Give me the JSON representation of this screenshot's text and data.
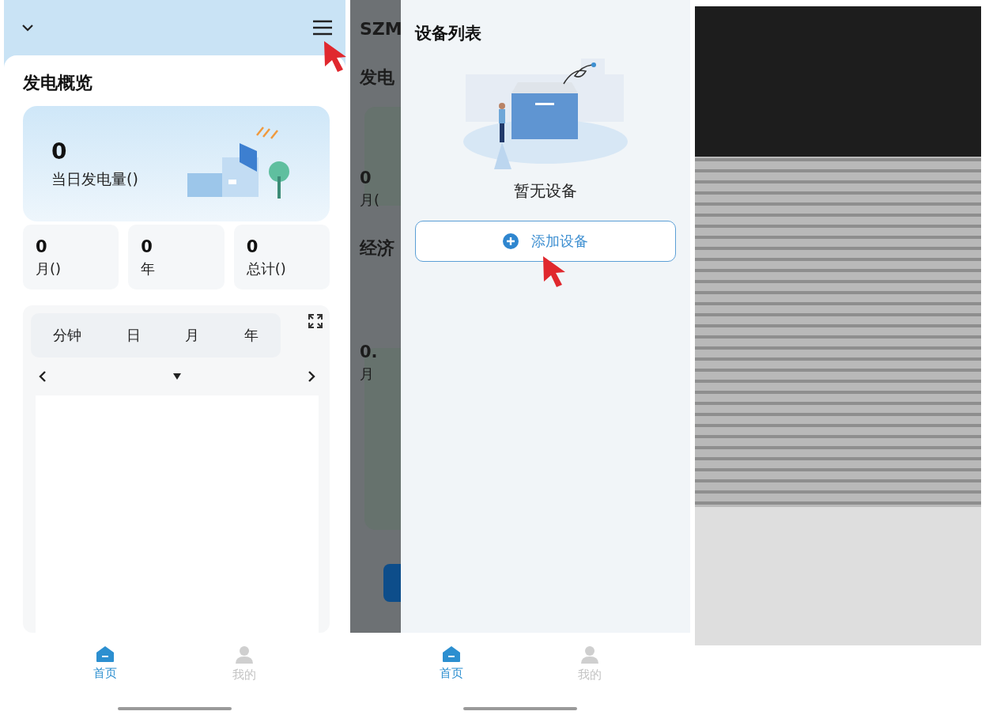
{
  "overview_screen": {
    "title": "发电概览",
    "today": {
      "value": "0",
      "label": "当日发电量()"
    },
    "stats": [
      {
        "value": "0",
        "label": "月()"
      },
      {
        "value": "0",
        "label": "年"
      },
      {
        "value": "0",
        "label": "总计()"
      }
    ],
    "period_tabs": [
      {
        "label": "分钟"
      },
      {
        "label": "日"
      },
      {
        "label": "月"
      },
      {
        "label": "年"
      }
    ],
    "tab_bar": [
      {
        "label": "首页",
        "selected": true
      },
      {
        "label": "我的",
        "selected": false
      }
    ]
  },
  "device_screen": {
    "background_texts": [
      {
        "text": "SZM",
        "kind": "title"
      },
      {
        "text": "发电",
        "kind": "title"
      },
      {
        "text": "0",
        "kind": "number"
      },
      {
        "text": "月(",
        "kind": "label"
      },
      {
        "text": "经济",
        "kind": "title"
      },
      {
        "text": "0.",
        "kind": "number"
      },
      {
        "text": "月",
        "kind": "label"
      }
    ],
    "drawer": {
      "title": "设备列表",
      "empty_text": "暂无设备",
      "add_button": "添加设备"
    },
    "tab_bar": [
      {
        "label": "首页",
        "selected": true
      },
      {
        "label": "我的",
        "selected": false
      }
    ]
  }
}
